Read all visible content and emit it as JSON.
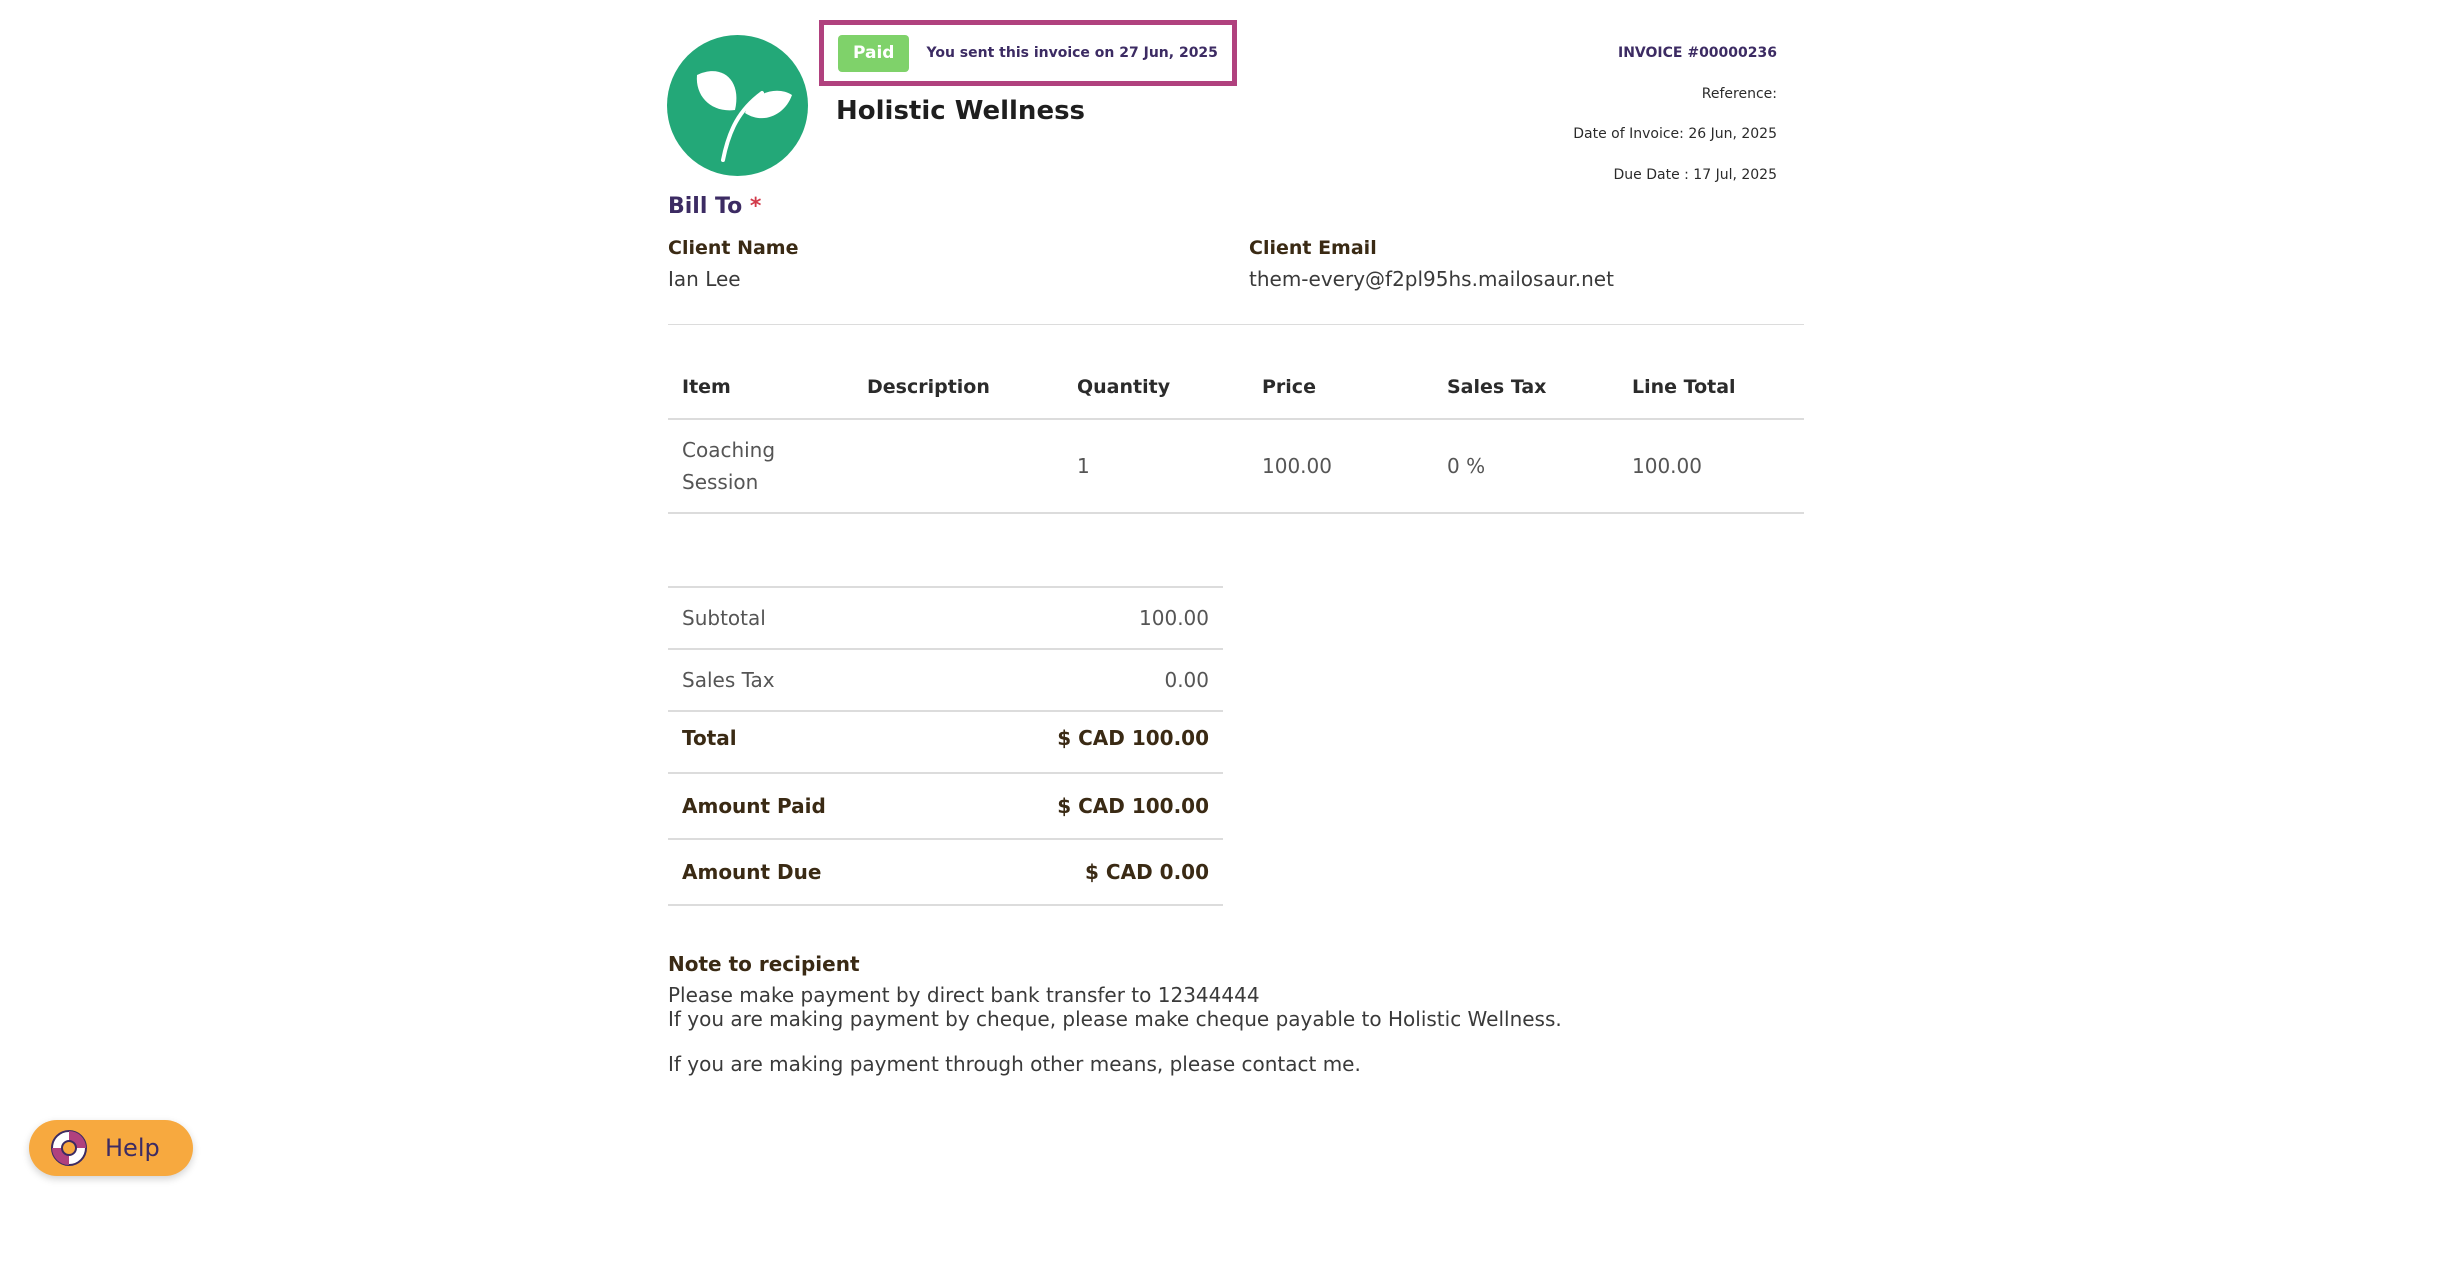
{
  "status": {
    "badge": "Paid",
    "sent_text": "You sent this invoice on 27 Jun, 2025"
  },
  "business": {
    "name": "Holistic Wellness",
    "logo_icon": "leaf-sprout-icon"
  },
  "invoice_meta": {
    "number": "INVOICE #00000236",
    "reference": "Reference:",
    "date_of_invoice": "Date of Invoice: 26 Jun, 2025",
    "due_date": "Due Date : 17 Jul, 2025"
  },
  "bill_to": {
    "title": "Bill To",
    "required_mark": "*",
    "client_name_label": "Client Name",
    "client_name": "Ian Lee",
    "client_email_label": "Client Email",
    "client_email": "them-every@f2pl95hs.mailosaur.net"
  },
  "items_table": {
    "headers": [
      "Item",
      "Description",
      "Quantity",
      "Price",
      "Sales Tax",
      "Line Total"
    ],
    "rows": [
      {
        "item": "Coaching Session",
        "description": "",
        "quantity": "1",
        "price": "100.00",
        "sales_tax": "0 %",
        "line_total": "100.00"
      }
    ]
  },
  "totals": {
    "subtotal_label": "Subtotal",
    "subtotal": "100.00",
    "sales_tax_label": "Sales Tax",
    "sales_tax": "0.00",
    "total_label": "Total",
    "total": "$ CAD 100.00",
    "amount_paid_label": "Amount Paid",
    "amount_paid": "$ CAD 100.00",
    "amount_due_label": "Amount Due",
    "amount_due": "$ CAD 0.00"
  },
  "note": {
    "title": "Note to recipient",
    "line1": "Please make payment by direct bank transfer to 12344444",
    "line2": "If you are making payment by cheque, please make cheque payable to Holistic Wellness.",
    "line3": "If you are making payment through other means, please contact me."
  },
  "help": {
    "label": "Help",
    "icon": "lifebuoy-icon"
  },
  "colors": {
    "logo_bg": "#23a878",
    "banner_border": "#b0417e",
    "paid_badge": "#7fd26a",
    "accent_purple": "#3c2b63",
    "help_bg": "#f7a93f"
  }
}
